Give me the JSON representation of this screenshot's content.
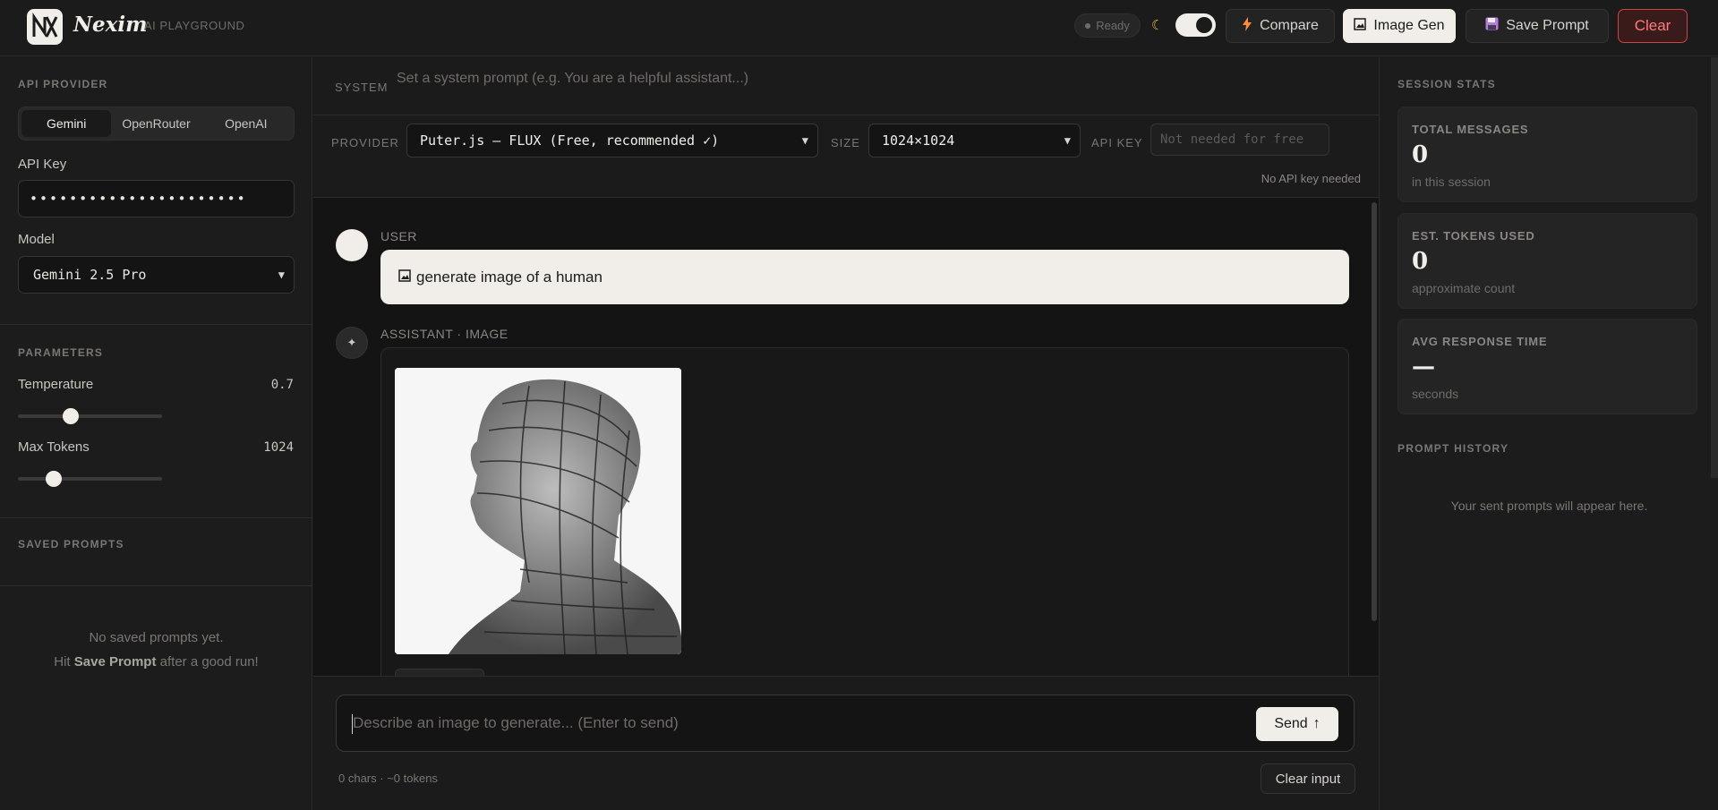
{
  "header": {
    "brand": "Nexim",
    "brand_sub": "AI PLAYGROUND",
    "status": "Ready",
    "compare_label": "Compare",
    "image_gen_label": "Image Gen",
    "save_prompt_label": "Save Prompt",
    "clear_label": "Clear"
  },
  "sidebar": {
    "api_provider_label": "API PROVIDER",
    "providers": [
      "Gemini",
      "OpenRouter",
      "OpenAI"
    ],
    "active_provider": "Gemini",
    "api_key_label": "API Key",
    "api_key_value": "••••••••••••••••••••••",
    "model_label": "Model",
    "model_value": "Gemini 2.5 Pro",
    "parameters_label": "PARAMETERS",
    "temperature_label": "Temperature",
    "temperature_value": "0.7",
    "temperature_fraction": 0.35,
    "max_tokens_label": "Max Tokens",
    "max_tokens_value": "1024",
    "max_tokens_fraction": 0.22,
    "saved_prompts_label": "SAVED PROMPTS",
    "saved_empty_line1": "No saved prompts yet.",
    "saved_empty_prefix": "Hit ",
    "saved_empty_bold": "Save Prompt",
    "saved_empty_suffix": " after a good run!"
  },
  "system": {
    "label": "SYSTEM",
    "placeholder": "Set a system prompt (e.g. You are a helpful assistant...)"
  },
  "config": {
    "provider_label": "PROVIDER",
    "provider_value": "Puter.js — FLUX (Free, recommended ✓)",
    "size_label": "SIZE",
    "size_value": "1024×1024",
    "api_key_label": "API KEY",
    "api_key_placeholder": "Not needed for free",
    "note": "No API key needed"
  },
  "chat": {
    "user_role": "USER",
    "user_message": "generate image of a human",
    "assistant_role": "ASSISTANT · IMAGE"
  },
  "composer": {
    "placeholder": "Describe an image to generate... (Enter to send)",
    "send_label": "Send",
    "counter": "0 chars · ~0 tokens",
    "clear_input_label": "Clear input"
  },
  "stats": {
    "title": "SESSION STATS",
    "items": [
      {
        "label": "TOTAL MESSAGES",
        "value": "0",
        "sub": "in this session"
      },
      {
        "label": "EST. TOKENS USED",
        "value": "0",
        "sub": "approximate count"
      },
      {
        "label": "AVG RESPONSE TIME",
        "value": "—",
        "sub": "seconds"
      }
    ],
    "history_title": "PROMPT HISTORY",
    "history_empty": "Your sent prompts will appear here."
  },
  "icons": {
    "logo": "nx-logo-icon",
    "compare": "lightning-icon",
    "image_gen": "frame-picture-icon",
    "save": "floppy-disk-icon",
    "send": "arrow-up-icon"
  },
  "colors": {
    "accent_light": "#f1eee9",
    "danger": "#ff7a7a",
    "lightning": "#ff8a3d"
  }
}
